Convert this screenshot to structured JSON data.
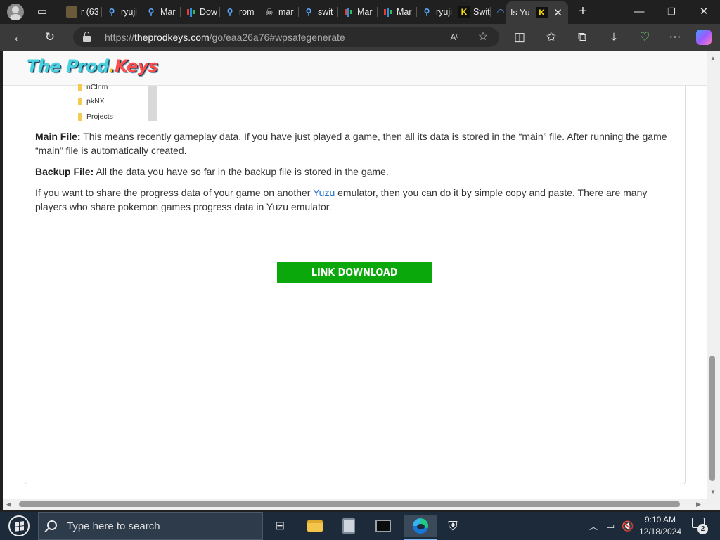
{
  "browser": {
    "tabs": [
      {
        "label": "r (63",
        "icon": "folder-icon"
      },
      {
        "label": "ryuji",
        "icon": "search-icon"
      },
      {
        "label": "Mar",
        "icon": "search-icon"
      },
      {
        "label": "Dow",
        "icon": "bar-chart-icon"
      },
      {
        "label": "rom",
        "icon": "search-icon"
      },
      {
        "label": "mar",
        "icon": "ghost-icon"
      },
      {
        "label": "swit",
        "icon": "search-icon"
      },
      {
        "label": "Mar",
        "icon": "bar-chart-icon"
      },
      {
        "label": "Mar",
        "icon": "bar-chart-icon"
      },
      {
        "label": "ryuji",
        "icon": "search-icon"
      },
      {
        "label": "Swit",
        "icon": "k-logo-icon"
      },
      {
        "label": "",
        "icon": "loading-icon"
      },
      {
        "label": "Is Yu",
        "icon": "k-logo-icon",
        "active": true
      }
    ],
    "url_prefix": "https://",
    "url_domain": "theprodkeys.com",
    "url_path": "/go/eaa26a76#wpsafegenerate"
  },
  "site": {
    "logo_part1": "The Prod",
    "logo_part2": ".",
    "logo_part3": "Keys"
  },
  "explorer_rows": [
    "nClnm",
    "pkNX",
    "Projects"
  ],
  "article": {
    "p1_bold": "Main File:",
    "p1_text": " This means recently gameplay data. If you have just played a game, then all its data is stored in the “main” file. After running the game “main” file is automatically created.",
    "p2_bold": "Backup File:",
    "p2_text": " All the data you have so far in the backup file is stored in the game.",
    "p3_before": "If you want to share the progress data of your game on another ",
    "p3_link": "Yuzu",
    "p3_after": " emulator, then you can do it by simple copy and paste. There are many players who share pokemon games progress data in Yuzu emulator."
  },
  "download_button": "LINK DOWNLOAD",
  "taskbar": {
    "search_placeholder": "Type here to search",
    "time": "9:10 AM",
    "date": "12/18/2024",
    "notification_count": "2"
  },
  "colors": {
    "download_button": "#0aa80a",
    "link": "#2270c9",
    "taskbar": "#1c2a3a"
  }
}
